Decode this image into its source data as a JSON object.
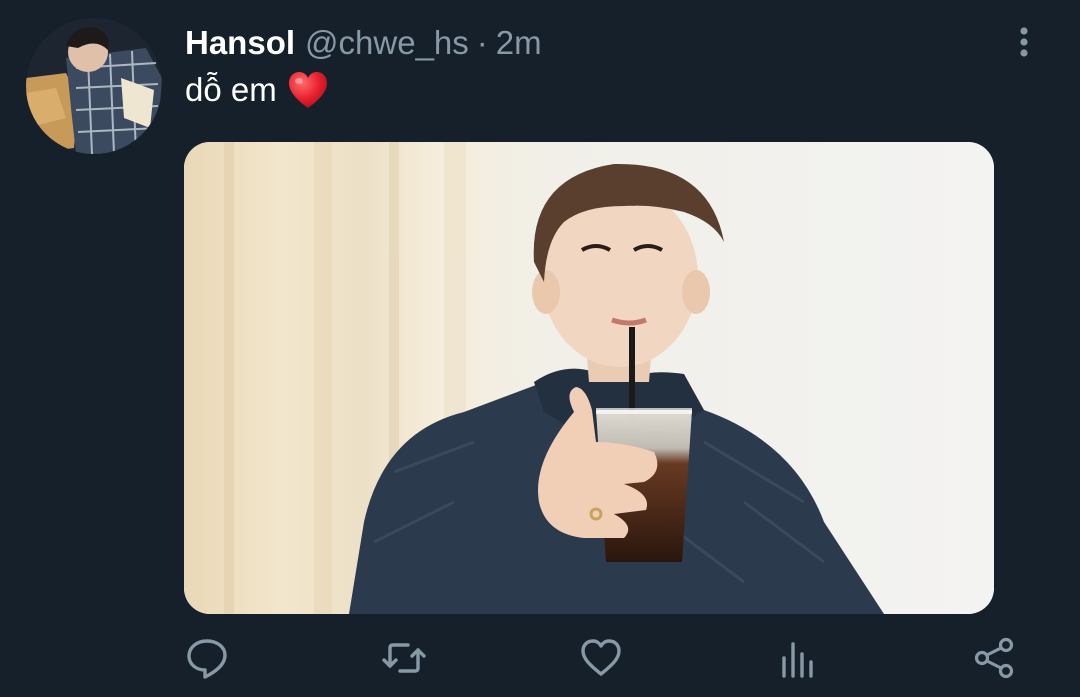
{
  "tweet": {
    "author": {
      "display_name": "Hansol",
      "handle": "@chwe_hs",
      "avatar_icon": "profile-photo"
    },
    "separator": "·",
    "time": "2m",
    "text": "dỗ em",
    "emoji": "red-heart",
    "media": {
      "description": "photo-person-with-iced-drink"
    },
    "actions": [
      {
        "name": "reply",
        "icon": "speech-bubble-icon"
      },
      {
        "name": "retweet",
        "icon": "retweet-arrows-icon"
      },
      {
        "name": "like",
        "icon": "heart-outline-icon"
      },
      {
        "name": "analytics",
        "icon": "bar-chart-icon"
      },
      {
        "name": "share",
        "icon": "share-nodes-icon"
      }
    ]
  },
  "colors": {
    "background": "#15202b",
    "primary_text": "#ffffff",
    "secondary_text": "#8899a6",
    "heart": "#e0245e"
  }
}
